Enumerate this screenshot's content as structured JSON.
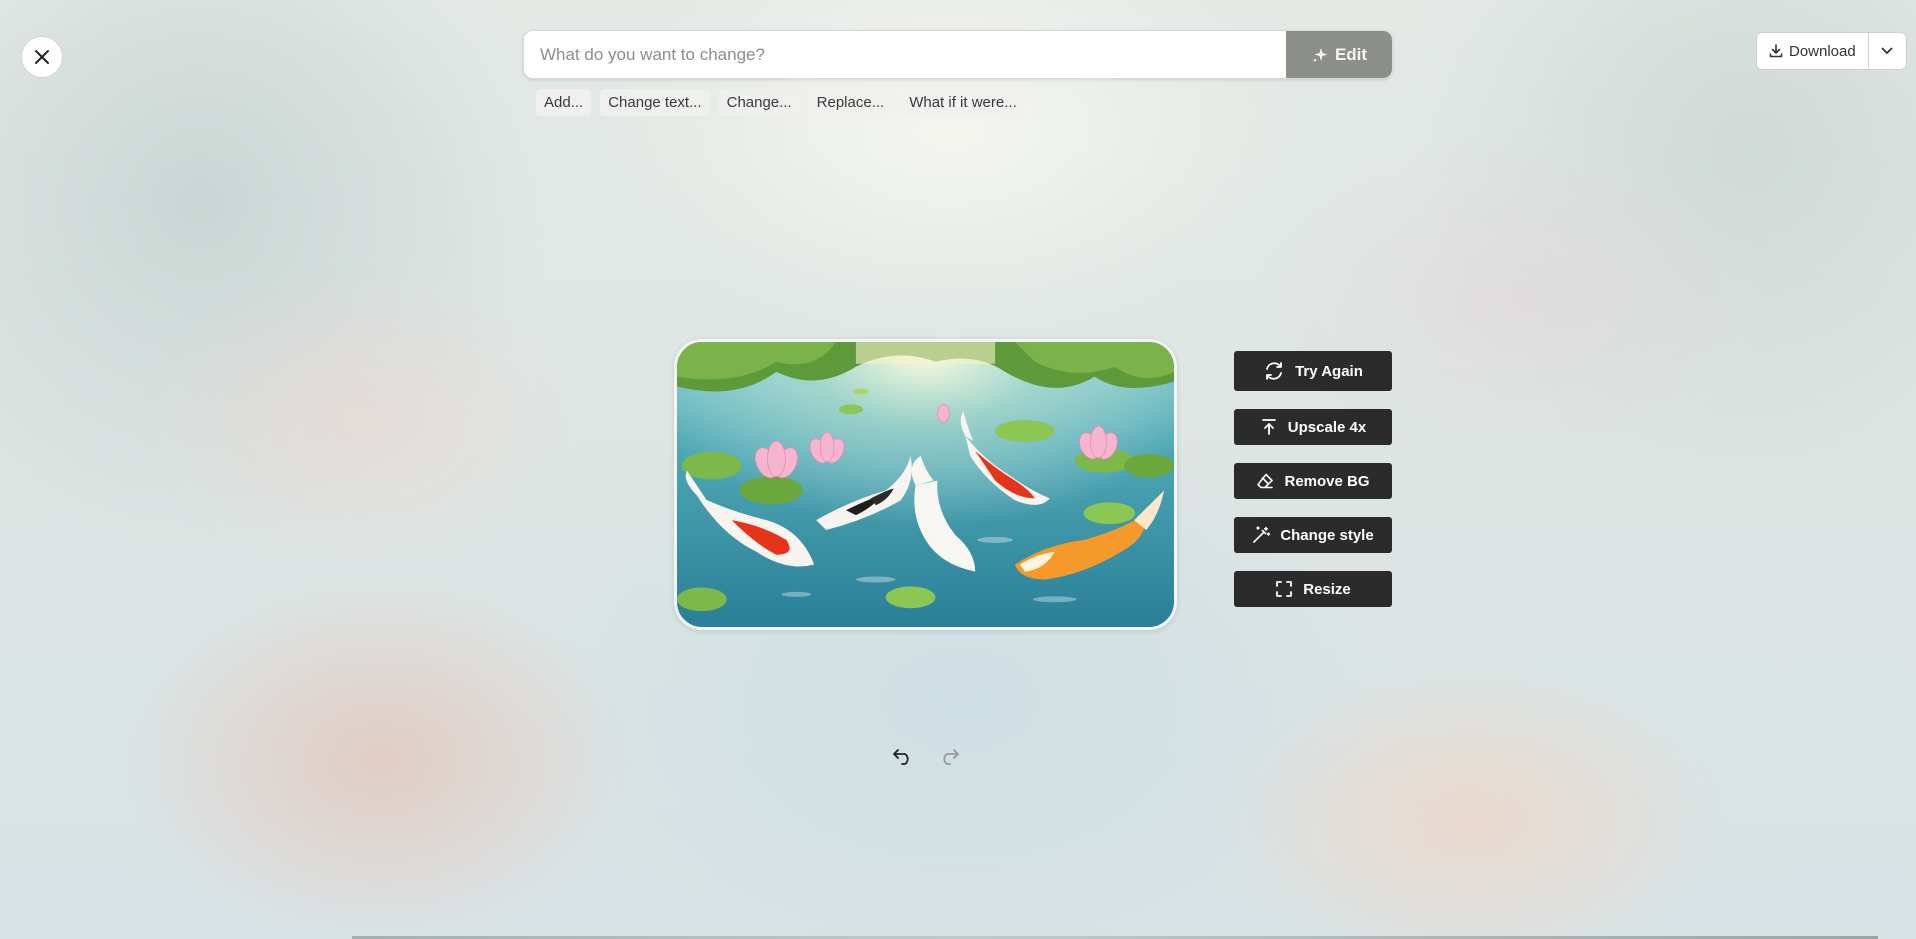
{
  "prompt": {
    "placeholder": "What do you want to change?",
    "value": "",
    "edit_label": "Edit",
    "edit_icon": "sparkle-icon"
  },
  "suggestions": [
    "Add...",
    "Change text...",
    "Change...",
    "Replace...",
    "What if it were..."
  ],
  "download": {
    "label": "Download",
    "icon": "download-icon",
    "menu_icon": "chevron-down-icon"
  },
  "image": {
    "subject": "koi-pond"
  },
  "actions": [
    {
      "label": "Try Again",
      "icon": "refresh-icon"
    },
    {
      "label": "Upscale 4x",
      "icon": "upscale-icon"
    },
    {
      "label": "Remove BG",
      "icon": "eraser-icon"
    },
    {
      "label": "Change style",
      "icon": "magic-wand-icon"
    },
    {
      "label": "Resize",
      "icon": "resize-icon"
    }
  ],
  "history": {
    "undo_icon": "undo-icon",
    "redo_icon": "redo-icon",
    "redo_enabled": false
  },
  "colors": {
    "action_bg": "#2b2b2b",
    "edit_bg": "#8b8e89"
  }
}
